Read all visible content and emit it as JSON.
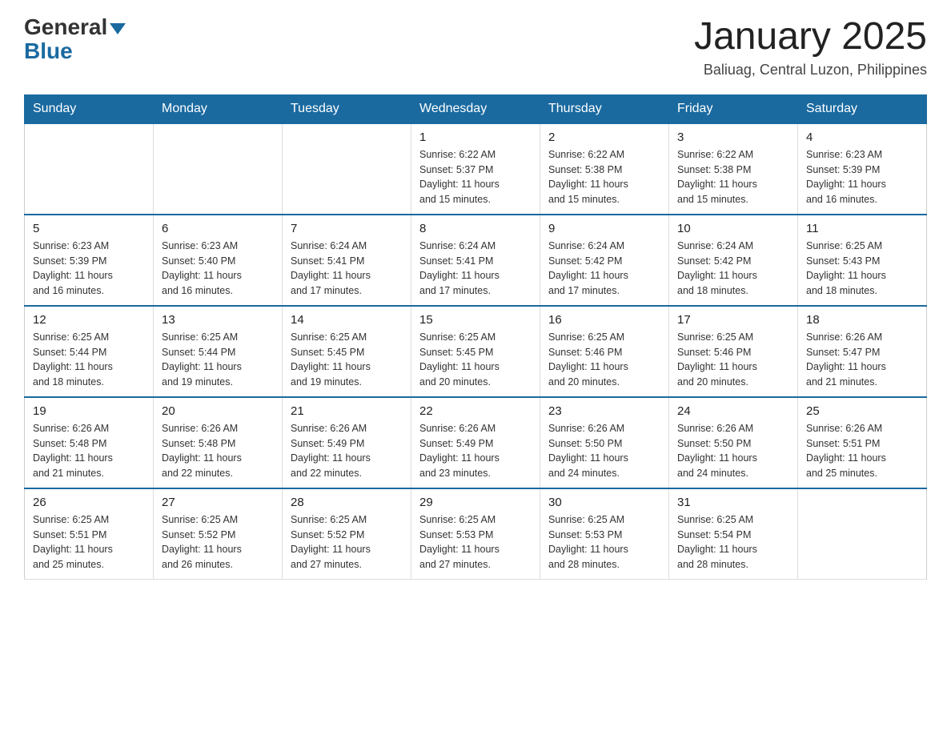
{
  "logo": {
    "general": "General",
    "blue": "Blue",
    "triangle_symbol": "▼"
  },
  "header": {
    "title": "January 2025",
    "subtitle": "Baliuag, Central Luzon, Philippines"
  },
  "days_of_week": [
    "Sunday",
    "Monday",
    "Tuesday",
    "Wednesday",
    "Thursday",
    "Friday",
    "Saturday"
  ],
  "weeks": [
    [
      {
        "day": "",
        "sunrise": "",
        "sunset": "",
        "daylight": ""
      },
      {
        "day": "",
        "sunrise": "",
        "sunset": "",
        "daylight": ""
      },
      {
        "day": "",
        "sunrise": "",
        "sunset": "",
        "daylight": ""
      },
      {
        "day": "1",
        "sunrise": "6:22 AM",
        "sunset": "5:37 PM",
        "daylight": "11 hours and 15 minutes."
      },
      {
        "day": "2",
        "sunrise": "6:22 AM",
        "sunset": "5:38 PM",
        "daylight": "11 hours and 15 minutes."
      },
      {
        "day": "3",
        "sunrise": "6:22 AM",
        "sunset": "5:38 PM",
        "daylight": "11 hours and 15 minutes."
      },
      {
        "day": "4",
        "sunrise": "6:23 AM",
        "sunset": "5:39 PM",
        "daylight": "11 hours and 16 minutes."
      }
    ],
    [
      {
        "day": "5",
        "sunrise": "6:23 AM",
        "sunset": "5:39 PM",
        "daylight": "11 hours and 16 minutes."
      },
      {
        "day": "6",
        "sunrise": "6:23 AM",
        "sunset": "5:40 PM",
        "daylight": "11 hours and 16 minutes."
      },
      {
        "day": "7",
        "sunrise": "6:24 AM",
        "sunset": "5:41 PM",
        "daylight": "11 hours and 17 minutes."
      },
      {
        "day": "8",
        "sunrise": "6:24 AM",
        "sunset": "5:41 PM",
        "daylight": "11 hours and 17 minutes."
      },
      {
        "day": "9",
        "sunrise": "6:24 AM",
        "sunset": "5:42 PM",
        "daylight": "11 hours and 17 minutes."
      },
      {
        "day": "10",
        "sunrise": "6:24 AM",
        "sunset": "5:42 PM",
        "daylight": "11 hours and 18 minutes."
      },
      {
        "day": "11",
        "sunrise": "6:25 AM",
        "sunset": "5:43 PM",
        "daylight": "11 hours and 18 minutes."
      }
    ],
    [
      {
        "day": "12",
        "sunrise": "6:25 AM",
        "sunset": "5:44 PM",
        "daylight": "11 hours and 18 minutes."
      },
      {
        "day": "13",
        "sunrise": "6:25 AM",
        "sunset": "5:44 PM",
        "daylight": "11 hours and 19 minutes."
      },
      {
        "day": "14",
        "sunrise": "6:25 AM",
        "sunset": "5:45 PM",
        "daylight": "11 hours and 19 minutes."
      },
      {
        "day": "15",
        "sunrise": "6:25 AM",
        "sunset": "5:45 PM",
        "daylight": "11 hours and 20 minutes."
      },
      {
        "day": "16",
        "sunrise": "6:25 AM",
        "sunset": "5:46 PM",
        "daylight": "11 hours and 20 minutes."
      },
      {
        "day": "17",
        "sunrise": "6:25 AM",
        "sunset": "5:46 PM",
        "daylight": "11 hours and 20 minutes."
      },
      {
        "day": "18",
        "sunrise": "6:26 AM",
        "sunset": "5:47 PM",
        "daylight": "11 hours and 21 minutes."
      }
    ],
    [
      {
        "day": "19",
        "sunrise": "6:26 AM",
        "sunset": "5:48 PM",
        "daylight": "11 hours and 21 minutes."
      },
      {
        "day": "20",
        "sunrise": "6:26 AM",
        "sunset": "5:48 PM",
        "daylight": "11 hours and 22 minutes."
      },
      {
        "day": "21",
        "sunrise": "6:26 AM",
        "sunset": "5:49 PM",
        "daylight": "11 hours and 22 minutes."
      },
      {
        "day": "22",
        "sunrise": "6:26 AM",
        "sunset": "5:49 PM",
        "daylight": "11 hours and 23 minutes."
      },
      {
        "day": "23",
        "sunrise": "6:26 AM",
        "sunset": "5:50 PM",
        "daylight": "11 hours and 24 minutes."
      },
      {
        "day": "24",
        "sunrise": "6:26 AM",
        "sunset": "5:50 PM",
        "daylight": "11 hours and 24 minutes."
      },
      {
        "day": "25",
        "sunrise": "6:26 AM",
        "sunset": "5:51 PM",
        "daylight": "11 hours and 25 minutes."
      }
    ],
    [
      {
        "day": "26",
        "sunrise": "6:25 AM",
        "sunset": "5:51 PM",
        "daylight": "11 hours and 25 minutes."
      },
      {
        "day": "27",
        "sunrise": "6:25 AM",
        "sunset": "5:52 PM",
        "daylight": "11 hours and 26 minutes."
      },
      {
        "day": "28",
        "sunrise": "6:25 AM",
        "sunset": "5:52 PM",
        "daylight": "11 hours and 27 minutes."
      },
      {
        "day": "29",
        "sunrise": "6:25 AM",
        "sunset": "5:53 PM",
        "daylight": "11 hours and 27 minutes."
      },
      {
        "day": "30",
        "sunrise": "6:25 AM",
        "sunset": "5:53 PM",
        "daylight": "11 hours and 28 minutes."
      },
      {
        "day": "31",
        "sunrise": "6:25 AM",
        "sunset": "5:54 PM",
        "daylight": "11 hours and 28 minutes."
      },
      {
        "day": "",
        "sunrise": "",
        "sunset": "",
        "daylight": ""
      }
    ]
  ]
}
